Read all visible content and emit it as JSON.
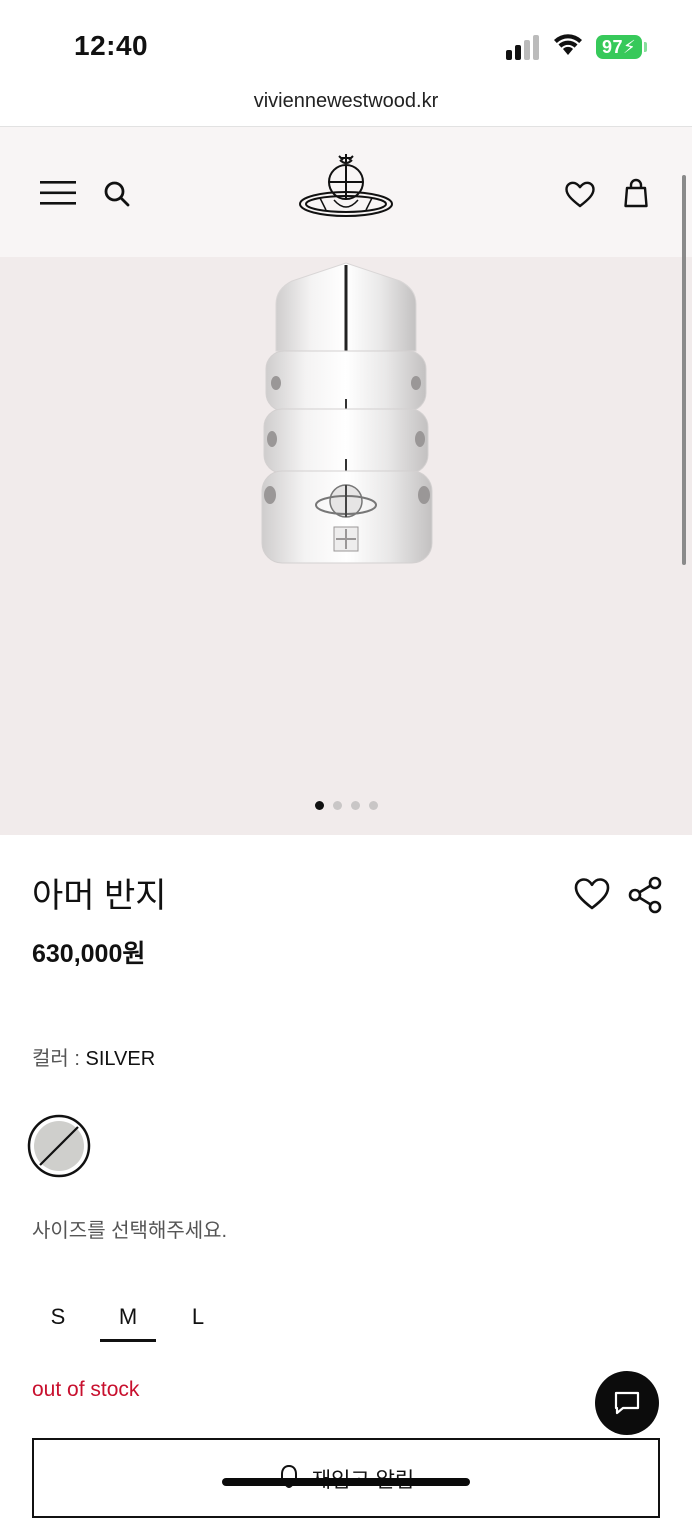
{
  "status_bar": {
    "time": "12:40",
    "battery": "97"
  },
  "browser": {
    "url": "viviennewestwood.kr"
  },
  "header": {
    "menu_icon": "hamburger-menu-icon",
    "search_icon": "search-icon",
    "logo_icon": "orb-logo-icon",
    "wishlist_icon": "heart-icon",
    "bag_icon": "shopping-bag-icon"
  },
  "gallery": {
    "image_count": 4,
    "active_index": 0
  },
  "product": {
    "title": "아머 반지",
    "price": "630,000원",
    "color_key": "컬러 : ",
    "color_value": "SILVER",
    "size_hint": "사이즈를 선택해주세요.",
    "sizes": [
      "S",
      "M",
      "L"
    ],
    "selected_size": "M",
    "stock_status": "out of stock",
    "restock_label": "재입고 알림"
  },
  "colors": {
    "accent": "#111111",
    "stock_red": "#c8102e",
    "gallery_bg": "#f1ebeb",
    "header_bg": "#f8f5f5",
    "battery_green": "#37c95a"
  }
}
